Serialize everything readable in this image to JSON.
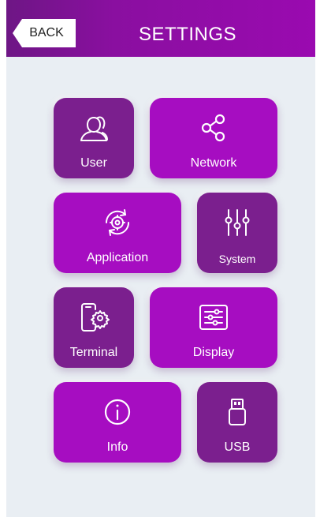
{
  "header": {
    "back_label": "BACK",
    "title": "SETTINGS"
  },
  "tiles": {
    "user": {
      "label": "User",
      "icon": "user-icon"
    },
    "network": {
      "label": "Network",
      "icon": "share-network-icon"
    },
    "application": {
      "label": "Application",
      "icon": "app-gear-refresh-icon"
    },
    "system": {
      "label": "System",
      "icon": "sliders-icon"
    },
    "terminal": {
      "label": "Terminal",
      "icon": "terminal-phone-gear-icon"
    },
    "display": {
      "label": "Display",
      "icon": "display-sliders-icon"
    },
    "info": {
      "label": "Info",
      "icon": "info-icon"
    },
    "usb": {
      "label": "USB",
      "icon": "usb-icon"
    }
  },
  "colors": {
    "header_start": "#6e1685",
    "header_end": "#9a0ab0",
    "tile_dark": "#7b1f8e",
    "tile_bright": "#a60dc1",
    "background": "#e9eef3"
  }
}
